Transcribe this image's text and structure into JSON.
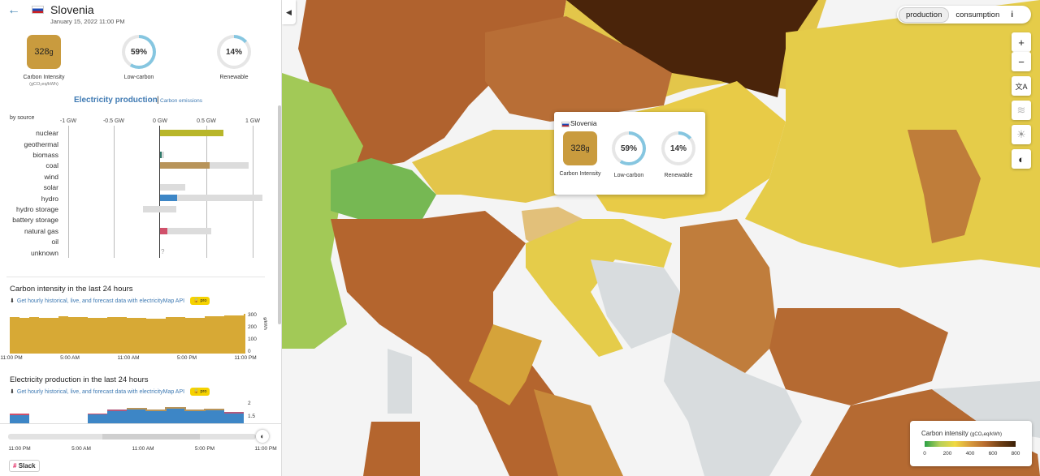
{
  "panel": {
    "country": "Slovenia",
    "datetime": "January 15, 2022 11:00 PM",
    "carbon_intensity_value": "328",
    "carbon_intensity_unit": "g",
    "carbon_intensity_label": "Carbon Intensity",
    "carbon_intensity_unit_label": "(gCO₂eq/kWh)",
    "low_carbon_value": "59%",
    "low_carbon_label": "Low-carbon",
    "renewable_value": "14%",
    "renewable_label": "Renewable",
    "low_carbon_fraction": 0.59,
    "renewable_fraction": 0.14,
    "tab_production": "Electricity production",
    "tab_separator": "|",
    "tab_emissions": "Carbon emissions",
    "by_source": "by source",
    "collapse_icon": "◀"
  },
  "production_chart": {
    "ticks": [
      "-1 GW",
      "-0.5 GW",
      "0 GW",
      "0.5 GW",
      "1 GW"
    ],
    "sources": [
      "nuclear",
      "geothermal",
      "biomass",
      "coal",
      "wind",
      "solar",
      "hydro",
      "hydro storage",
      "battery storage",
      "natural gas",
      "oil",
      "unknown"
    ],
    "unknown_mark": "?",
    "colors": {
      "nuclear": "#b8b62a",
      "biomass": "#2f7a6a",
      "coal": "#b8945a",
      "hydro": "#3d86c6",
      "natural_gas": "#d0506a",
      "capacity": "#dcdcdc"
    }
  },
  "ci_history": {
    "title": "Carbon intensity in the last 24 hours",
    "api_text": "Get hourly historical, live, and forecast data with electricityMap API",
    "pro_label": "pro",
    "y_ticks": [
      "300",
      "200",
      "100",
      "0"
    ],
    "y_unit": "g/kWh",
    "x_ticks": [
      "11:00 PM",
      "5:00 AM",
      "11:00 AM",
      "5:00 PM",
      "11:00 PM"
    ],
    "fill_color": "#d7a935"
  },
  "prod_history": {
    "title": "Electricity production in the last 24 hours",
    "api_text": "Get hourly historical, live, and forecast data with electricityMap API",
    "pro_label": "pro",
    "y_ticks": [
      "2",
      "1.5"
    ]
  },
  "slider": {
    "ticks": [
      "11:00 PM",
      "5:00 AM",
      "11:00 AM",
      "5:00 PM",
      "11:00 PM"
    ],
    "handle_icon": "moon-icon"
  },
  "footer": {
    "slack_label": "Slack"
  },
  "map": {
    "toggle": {
      "production": "production",
      "consumption": "consumption",
      "info": "i"
    },
    "buttons": [
      "+",
      "−",
      "文A",
      "≋",
      "☀",
      "◐"
    ],
    "tooltip": {
      "country": "Slovenia",
      "carbon_value": "328",
      "carbon_unit": "g",
      "carbon_label": "Carbon Intensity",
      "low_carbon_value": "59%",
      "low_carbon_label": "Low-carbon",
      "renewable_value": "14%",
      "renewable_label": "Renewable"
    },
    "legend": {
      "title": "Carbon intensity",
      "unit": "(gCO₂eq/kWh)",
      "ticks": [
        "0",
        "200",
        "400",
        "600",
        "800"
      ]
    }
  }
}
